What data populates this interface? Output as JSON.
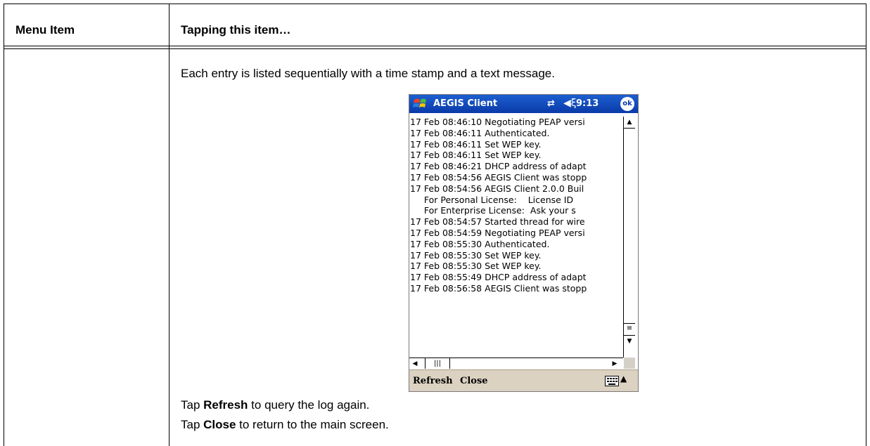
{
  "table": {
    "col1_header": "Menu Item",
    "col2_header": "Tapping this item…",
    "intro": "Each entry is listed sequentially with a time stamp and a text message.",
    "tap_refresh": {
      "prefix": "Tap ",
      "bold": "Refresh",
      "suffix": " to query the log again."
    },
    "tap_close": {
      "prefix": "Tap ",
      "bold": "Close",
      "suffix": " to return to the main screen."
    }
  },
  "device": {
    "app_title": "AEGIS Client",
    "time": "9:13",
    "ok_label": "ok",
    "status_icons": [
      "network-icon",
      "volume-icon"
    ],
    "log_lines": [
      "17 Feb 08:46:10 Negotiating PEAP versi",
      "17 Feb 08:46:11 Authenticated.",
      "17 Feb 08:46:11 Set WEP key.",
      "17 Feb 08:46:11 Set WEP key.",
      "17 Feb 08:46:21 DHCP address of adapt",
      "17 Feb 08:54:56 AEGIS Client was stopp",
      "17 Feb 08:54:56 AEGIS Client 2.0.0 Buil",
      "     For Personal License:    License ID",
      "     For Enterprise License:  Ask your s",
      "17 Feb 08:54:57 Started thread for wire",
      "17 Feb 08:54:59 Negotiating PEAP versi",
      "17 Feb 08:55:30 Authenticated.",
      "17 Feb 08:55:30 Set WEP key.",
      "17 Feb 08:55:30 Set WEP key.",
      "17 Feb 08:55:49 DHCP address of adapt",
      "17 Feb 08:56:58 AEGIS Client was stopp"
    ],
    "menu": {
      "refresh": "Refresh",
      "close": "Close"
    }
  },
  "colors": {
    "title_bar": "#0a3aa8",
    "menu_bar": "#dcd2c2"
  }
}
